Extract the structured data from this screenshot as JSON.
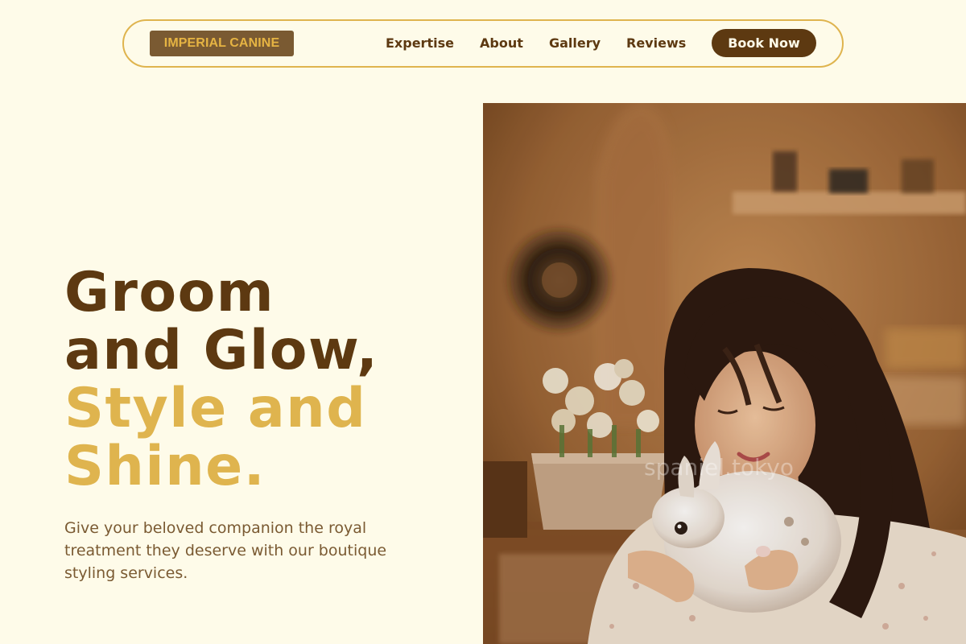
{
  "nav": {
    "logo": "IMPERIAL CANINE",
    "links": [
      "Expertise",
      "About",
      "Gallery",
      "Reviews"
    ],
    "cta": "Book Now"
  },
  "hero": {
    "title_line1": "Groom",
    "title_line2": "and Glow,",
    "title_line3": "Style and",
    "title_line4": "Shine.",
    "subtitle": "Give your beloved companion the royal treatment they deserve with our boutique styling services.",
    "image_watermark": "spaniel.tokyo"
  },
  "colors": {
    "background": "#fefbe9",
    "brown": "#5d3911",
    "gold": "#dfb44e",
    "muted_brown": "#7a5a32"
  }
}
